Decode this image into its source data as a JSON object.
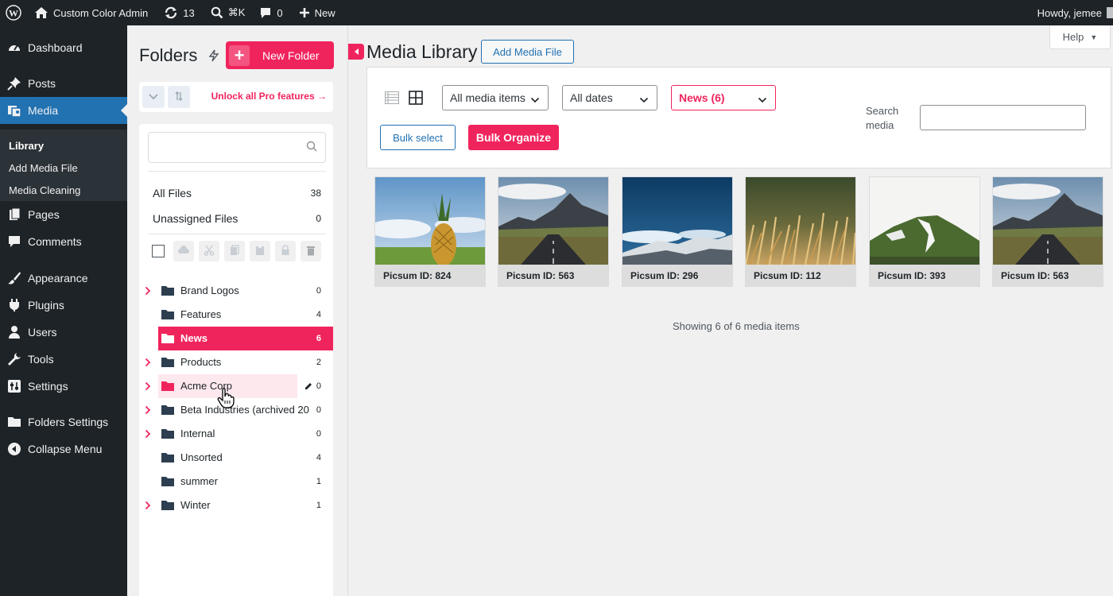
{
  "adminbar": {
    "site_name": "Custom Color Admin",
    "updates_count": "13",
    "search_shortcut": "⌘K",
    "comments_count": "0",
    "new_label": "New",
    "howdy": "Howdy, jemee"
  },
  "sidebar": {
    "items": [
      {
        "label": "Dashboard",
        "icon": "dashboard-icon"
      },
      {
        "label": "Posts",
        "icon": "pin-icon"
      },
      {
        "label": "Media",
        "icon": "media-icon"
      },
      {
        "label": "Pages",
        "icon": "page-icon"
      },
      {
        "label": "Comments",
        "icon": "comment-icon"
      },
      {
        "label": "Appearance",
        "icon": "brush-icon"
      },
      {
        "label": "Plugins",
        "icon": "plug-icon"
      },
      {
        "label": "Users",
        "icon": "user-icon"
      },
      {
        "label": "Tools",
        "icon": "wrench-icon"
      },
      {
        "label": "Settings",
        "icon": "settings-icon"
      },
      {
        "label": "Folders Settings",
        "icon": "folder-icon"
      },
      {
        "label": "Collapse Menu",
        "icon": "collapse-icon"
      }
    ],
    "submenu": [
      "Library",
      "Add Media File",
      "Media Cleaning"
    ]
  },
  "folders": {
    "title": "Folders",
    "new_folder": "New Folder",
    "unlock": "Unlock all Pro features →",
    "all_files": {
      "label": "All Files",
      "count": "38"
    },
    "unassigned": {
      "label": "Unassigned Files",
      "count": "0"
    },
    "tree": [
      {
        "name": "Brand Logos",
        "count": "0"
      },
      {
        "name": "Features",
        "count": "4"
      },
      {
        "name": "News",
        "count": "6"
      },
      {
        "name": "Products",
        "count": "2"
      },
      {
        "name": "Acme Corp",
        "count": "0"
      },
      {
        "name": "Beta Industries (archived 20",
        "count": "0"
      },
      {
        "name": "Internal",
        "count": "0"
      },
      {
        "name": "Unsorted",
        "count": "4"
      },
      {
        "name": "summer",
        "count": "1"
      },
      {
        "name": "Winter",
        "count": "1"
      }
    ]
  },
  "main": {
    "title": "Media Library",
    "add_button": "Add Media File",
    "help": "Help",
    "filter_type": "All media items",
    "filter_date": "All dates",
    "filter_folder": "News (6)",
    "search_label": "Search media",
    "bulk_select": "Bulk select",
    "bulk_organize": "Bulk Organize",
    "items": [
      {
        "caption": "Picsum ID: 824"
      },
      {
        "caption": "Picsum ID: 563"
      },
      {
        "caption": "Picsum ID: 296"
      },
      {
        "caption": "Picsum ID: 112"
      },
      {
        "caption": "Picsum ID: 393"
      },
      {
        "caption": "Picsum ID: 563"
      }
    ],
    "count_text": "Showing 6 of 6 media items"
  },
  "colors": {
    "accent": "#f0245d",
    "wp_blue": "#2271b1",
    "sidebar_bg": "#1d2327"
  }
}
